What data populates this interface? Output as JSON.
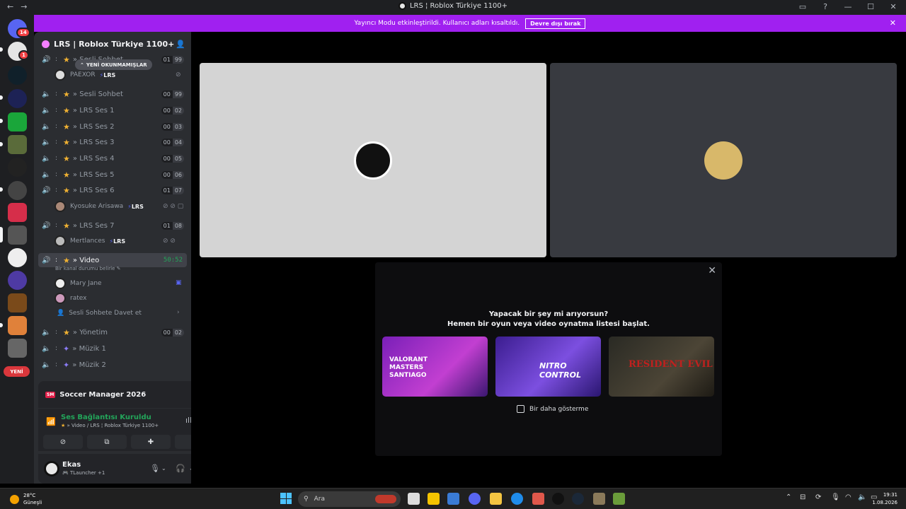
{
  "window": {
    "title": "LRS ¦ Roblox Türkiye 1100+",
    "back_icon": "←",
    "forward_icon": "→"
  },
  "banner": {
    "text": "Yayıncı Modu etkinleştirildi. Kullanıcı adları kısaltıldı.",
    "button": "Devre dışı bırak",
    "color": "#a020f0"
  },
  "guilds": {
    "badges": [
      "14",
      "1"
    ],
    "new_label": "YENİ"
  },
  "server": {
    "name": "LRS | Roblox Türkiye 1100+",
    "unread_pill": "YENİ OKUNMAMIŞLAR",
    "channels": [
      {
        "name": "» Sesli Sohbet",
        "counts": [
          "01",
          "99"
        ]
      },
      {
        "name": "» Sesli Sohbet",
        "counts": [
          "00",
          "99"
        ]
      },
      {
        "name": "» LRS Ses 1",
        "counts": [
          "00",
          "02"
        ]
      },
      {
        "name": "» LRS Ses 2",
        "counts": [
          "00",
          "03"
        ]
      },
      {
        "name": "» LRS Ses 3",
        "counts": [
          "00",
          "04"
        ]
      },
      {
        "name": "» LRS Ses 4",
        "counts": [
          "00",
          "05"
        ]
      },
      {
        "name": "» LRS Ses 5",
        "counts": [
          "00",
          "06"
        ]
      },
      {
        "name": "» LRS Ses 6",
        "counts": [
          "01",
          "07"
        ]
      },
      {
        "name": "» LRS Ses 7",
        "counts": [
          "01",
          "08"
        ]
      },
      {
        "name": "» Video",
        "timer": "50:52",
        "status": "Bir kanal durumu belirle"
      },
      {
        "name": "» Yönetim",
        "counts": [
          "00",
          "02"
        ]
      },
      {
        "name": "» Müzik 1"
      },
      {
        "name": "» Müzik 2"
      }
    ],
    "members": [
      {
        "name": "PAEXOR",
        "tag": "LRS"
      },
      {
        "name": "Kyosuke Arisawa",
        "tag": "LRS"
      },
      {
        "name": "Mertlances",
        "tag": "LRS"
      },
      {
        "name": "Mary Jane"
      },
      {
        "name": "ratex"
      }
    ],
    "invite": "Sesli Sohbete Davet et"
  },
  "activity": {
    "badge": "SM",
    "title": "Soccer Manager 2026"
  },
  "voice": {
    "status": "Ses Bağlantısı Kuruldu",
    "location": "» Video / LRS ¦ Roblox Türkiye 1100+"
  },
  "user": {
    "name": "Ekas",
    "status": "TLauncher +1"
  },
  "modal": {
    "line1": "Yapacak bir şey mi arıyorsun?",
    "line2": "Hemen bir oyun veya video oynatma listesi başlat.",
    "cards": [
      "VALORANT MASTERS SANTIAGO",
      "NITRO CONTROL",
      "RESIDENT EVIL"
    ],
    "checkbox": "Bir daha gösterme"
  },
  "taskbar": {
    "temp": "28°C",
    "weather": "Güneşli",
    "search_placeholder": "Ara",
    "time": "19:31",
    "date": "1.08.2026"
  },
  "colors": {
    "accent": "#5865f2",
    "green": "#23a55a",
    "bg_dark": "#1e1f22",
    "sidebar": "#2b2d31"
  }
}
